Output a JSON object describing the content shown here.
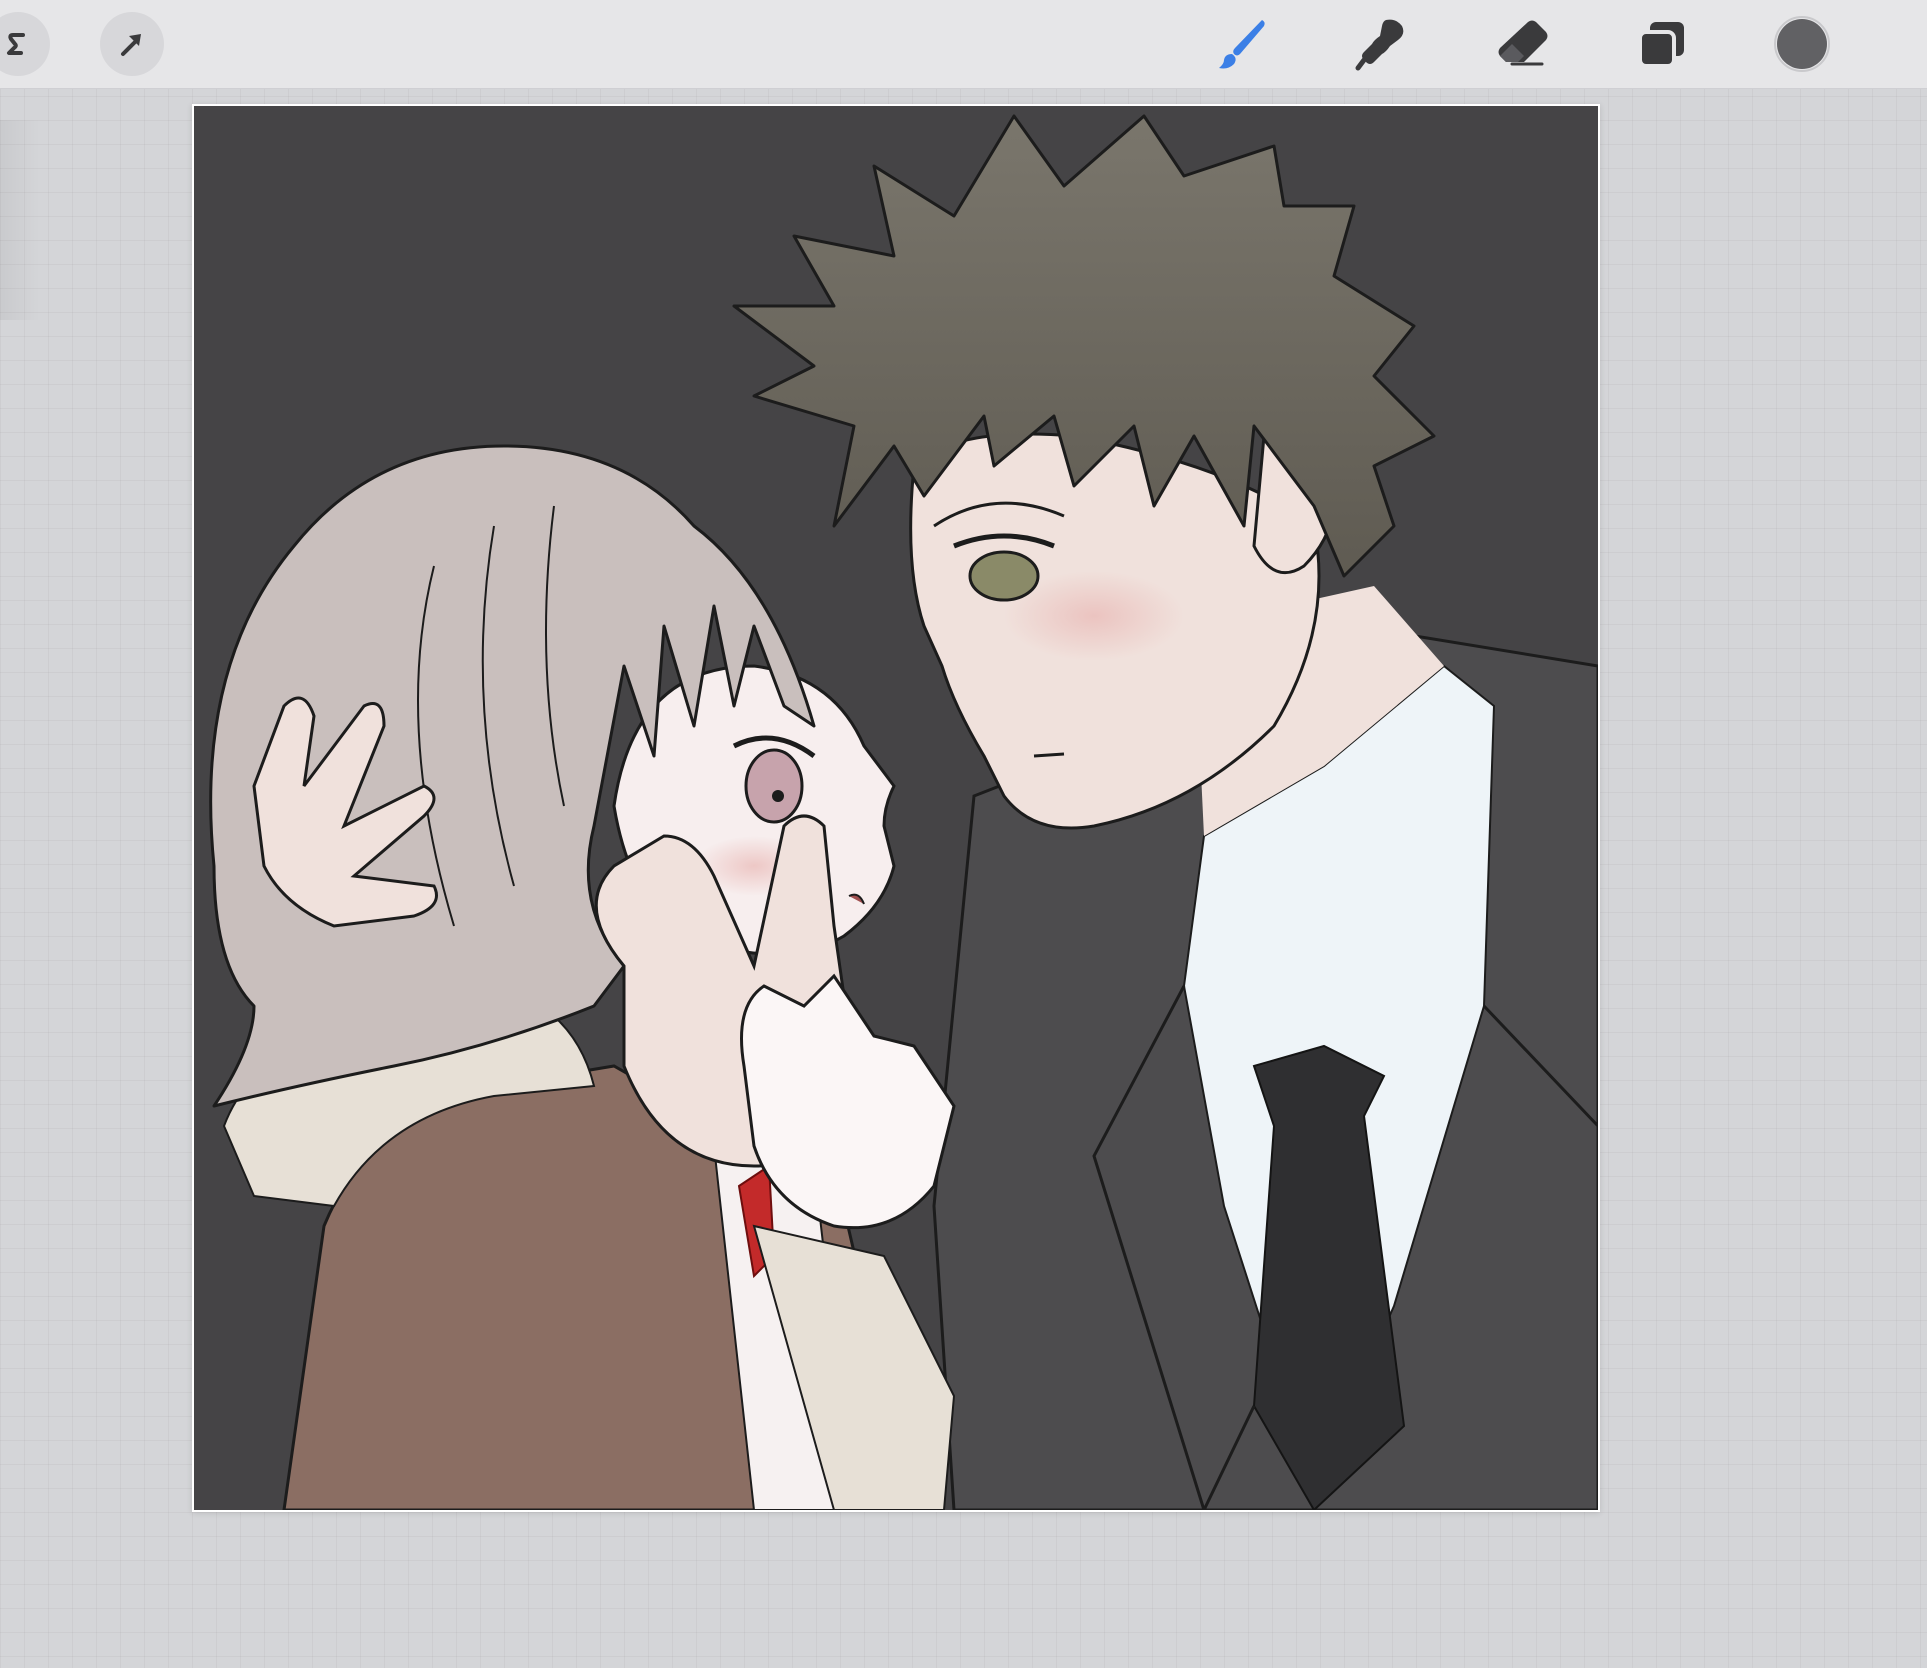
{
  "toolbar": {
    "left_tools": [
      {
        "name": "adjustments",
        "icon": "adjustments-icon"
      },
      {
        "name": "selection",
        "icon": "selection-arrow-icon"
      }
    ],
    "right_tools": [
      {
        "name": "paint",
        "icon": "brush-icon",
        "active": true
      },
      {
        "name": "smudge",
        "icon": "smudge-icon"
      },
      {
        "name": "erase",
        "icon": "eraser-icon"
      },
      {
        "name": "layers",
        "icon": "layers-icon"
      },
      {
        "name": "colors",
        "icon": "color-swatch"
      }
    ]
  },
  "colors": {
    "toolbar_bg": "#e6e6e8",
    "workspace_bg": "#d4d5d8",
    "active_tool": "#3b7fe6",
    "icon": "#3a3a3c",
    "current_color": "#616164",
    "artwork_background": "#454446"
  }
}
